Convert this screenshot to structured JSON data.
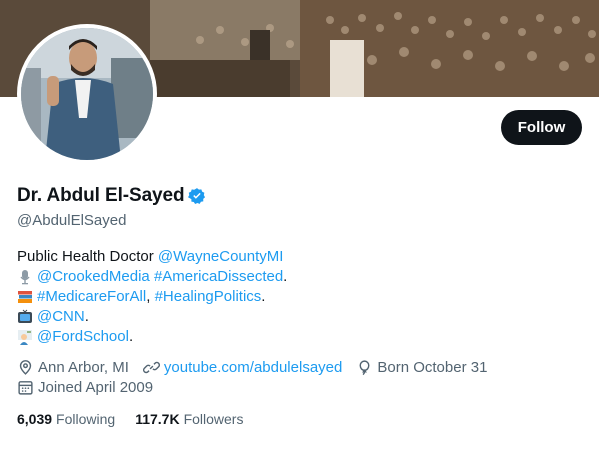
{
  "profile": {
    "display_name": "Dr. Abdul El-Sayed",
    "handle": "@AbdulElSayed",
    "follow_label": "Follow"
  },
  "bio": {
    "line1_text": "Public Health Doctor ",
    "line1_link": "@WayneCountyMI",
    "line2_link1": "@CrookedMedia",
    "line2_link2": "#AmericaDissected",
    "line2_end": ".",
    "line3_link1": "#MedicareForAll",
    "line3_sep": ", ",
    "line3_link2": "#HealingPolitics",
    "line3_end": ".",
    "line4_link": "@CNN",
    "line4_end": ".",
    "line5_link": "@FordSchool",
    "line5_end": "."
  },
  "meta": {
    "location": "Ann Arbor, MI",
    "website": "youtube.com/abdulelsayed",
    "birthday": "Born October 31",
    "joined": "Joined April 2009"
  },
  "stats": {
    "following_count": "6,039",
    "following_label": "Following",
    "followers_count": "117.7K",
    "followers_label": "Followers"
  },
  "colors": {
    "accent": "#1d9bf0",
    "text": "#0f1419",
    "muted": "#536471",
    "button": "#0f1419"
  },
  "icons": {
    "verified": "verified-badge-icon",
    "location": "location-pin-icon",
    "link": "link-icon",
    "birthday": "balloon-icon",
    "joined": "calendar-icon",
    "microphone": "microphone-emoji",
    "books": "books-emoji",
    "tv": "television-emoji",
    "teacher": "teacher-emoji"
  }
}
